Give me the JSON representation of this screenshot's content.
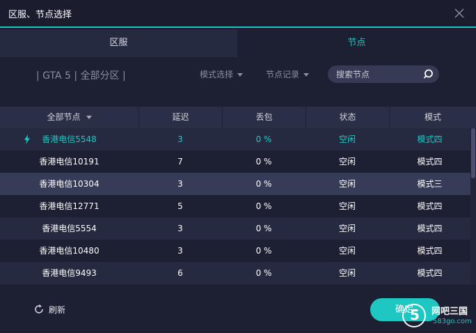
{
  "window": {
    "title": "区服、节点选择",
    "close_icon": "close-icon"
  },
  "tabs": [
    {
      "label": "区服",
      "active": false
    },
    {
      "label": "节点",
      "active": true
    }
  ],
  "filter": {
    "game_info": "| GTA 5 | 全部分区 |",
    "mode_select": "模式选择",
    "node_history": "节点记录",
    "search_placeholder": "搜索节点"
  },
  "table": {
    "headers": [
      "全部节点",
      "延迟",
      "丢包",
      "状态",
      "模式"
    ],
    "rows": [
      {
        "node": "香港电信5548",
        "latency": "3",
        "loss": "0 %",
        "status": "空闲",
        "mode": "模式四",
        "active": true
      },
      {
        "node": "香港电信10191",
        "latency": "7",
        "loss": "0 %",
        "status": "空闲",
        "mode": "模式四"
      },
      {
        "node": "香港电信10304",
        "latency": "3",
        "loss": "0 %",
        "status": "空闲",
        "mode": "模式三",
        "selected": true
      },
      {
        "node": "香港电信12771",
        "latency": "5",
        "loss": "0 %",
        "status": "空闲",
        "mode": "模式四"
      },
      {
        "node": "香港电信5554",
        "latency": "3",
        "loss": "0 %",
        "status": "空闲",
        "mode": "模式四"
      },
      {
        "node": "香港电信10480",
        "latency": "3",
        "loss": "0 %",
        "status": "空闲",
        "mode": "模式四"
      },
      {
        "node": "香港电信9493",
        "latency": "6",
        "loss": "0 %",
        "status": "空闲",
        "mode": "模式四"
      }
    ]
  },
  "footer": {
    "refresh_label": "刷新",
    "confirm_label": "确定"
  },
  "watermark": {
    "text": "网吧三国",
    "sub": "583go.com",
    "glyph": "5"
  },
  "colors": {
    "accent": "#1fc7c2",
    "background": "#1d1f33",
    "row_alt": "#262a40",
    "row_selected": "#363b58"
  }
}
